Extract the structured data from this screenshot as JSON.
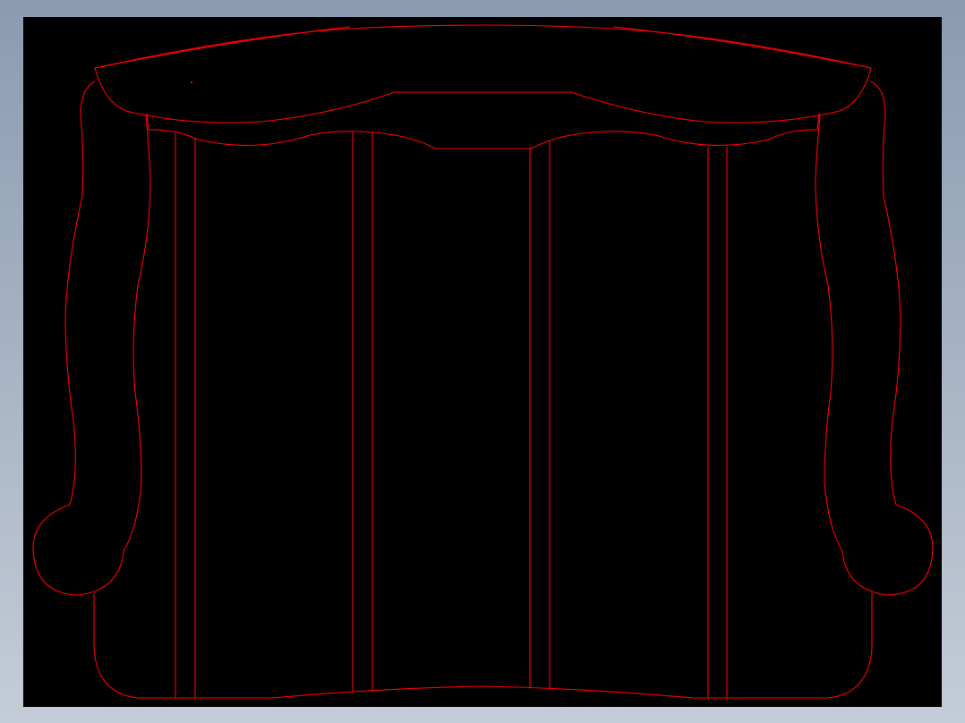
{
  "viewport": {
    "background_color": "#000000",
    "line_color": "#ff0000",
    "frame_color": "#a7b3c3"
  },
  "drawing": {
    "subject": "sofa-front-elevation",
    "panel_count": 4
  }
}
